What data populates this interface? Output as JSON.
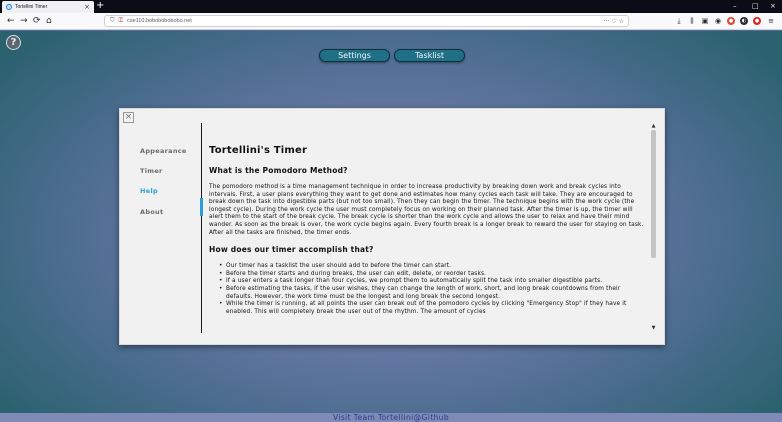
{
  "browser": {
    "tab_title": "Tortellini Timer",
    "tab_close": "×",
    "new_tab": "+",
    "window_controls": [
      "–",
      "□",
      "×"
    ],
    "url": "cse110.bobobobobobo.net",
    "url_actions": "··· ♡ ☆",
    "nav": {
      "back": "←",
      "forward": "→",
      "reload": "⟳",
      "home": "⌂"
    }
  },
  "page": {
    "help_icon": "?",
    "settings_label": "Settings",
    "tasklist_label": "Tasklist",
    "footer_link": "Visit Team Tortellini@Github"
  },
  "modal": {
    "close_label": "×",
    "nav": [
      {
        "label": "Appearance",
        "active": false
      },
      {
        "label": "Timer",
        "active": false
      },
      {
        "label": "Help",
        "active": true
      },
      {
        "label": "About",
        "active": false
      }
    ],
    "title": "Tortellini's Timer",
    "section1_heading": "What is the Pomodoro Method?",
    "section1_paragraph": "The pomodoro method is a time management technique in order to increase productivity by breaking down work and break cycles into intervals. First, a user plans everything they want to get done and estimates how many cycles each task will take. They are encouraged to break down the task into digestible parts (but not too small). Then they can begin the timer. The technique begins with the work cycle (the longest cycle). During the work cycle the user must completely focus on working on their planned task. After the timer is up, the timer will alert them to the start of the break cycle. The break cycle is shorter than the work cycle and allows the user to relax and have their mind wander. As soon as the break is over, the work cycle begins again. Every fourth break is a longer break to reward the user for staying on task. After all the tasks are finished, the timer ends.",
    "section2_heading": "How does our timer accomplish that?",
    "section2_items": [
      "Our timer has a tasklist the user should add to before the timer can start.",
      "Before the timer starts and during breaks, the user can edit, delete, or reorder tasks.",
      "If a user enters a task longer than four cycles, we prompt them to automatically split the task into smaller digestible parts.",
      "Before estimating the tasks, if the user wishes, they can change the length of work, short, and long break countdowns from their defaults. However, the work time must be the longest and long break the second longest.",
      "While the timer is running, at all points the user can break out of the pomodoro cycles by clicking \"Emergency Stop\" if they have it enabled. This will completely break the user out of the rhythm. The amount of cycles"
    ],
    "scroll_up": "▲",
    "scroll_down": "▼"
  },
  "colors": {
    "accent": "#2a9fd4",
    "button_bg": "#1f6f86",
    "modal_bg": "#f1f1f1"
  },
  "icons": [
    "back-icon",
    "forward-icon",
    "reload-icon",
    "home-icon",
    "shield-icon",
    "download-icon",
    "library-icon",
    "sidebar-icon",
    "account-icon",
    "extension-icon",
    "menu-icon",
    "help-icon",
    "close-icon"
  ]
}
